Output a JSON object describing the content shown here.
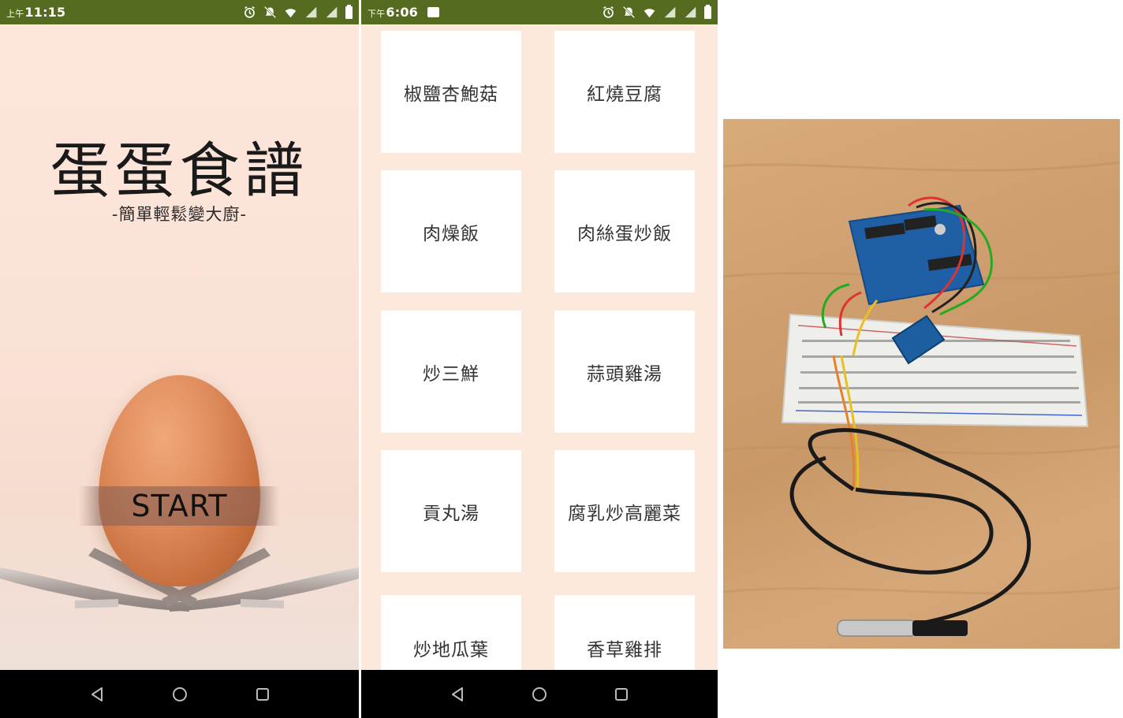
{
  "phone1": {
    "status": {
      "ampm": "上午",
      "time": "11:15"
    },
    "title": "蛋蛋食譜",
    "subtitle": "-簡單輕鬆變大廚-",
    "start_label": "START"
  },
  "phone2": {
    "status": {
      "ampm": "下午",
      "time": "6:06"
    },
    "recipes": [
      "椒鹽杏鮑菇",
      "紅燒豆腐",
      "肉燥飯",
      "肉絲蛋炒飯",
      "炒三鮮",
      "蒜頭雞湯",
      "貢丸湯",
      "腐乳炒高麗菜",
      "炒地瓜葉",
      "香草雞排"
    ]
  },
  "colors": {
    "statusbar": "#556b1f",
    "phone1_bg": "#fbe2d6",
    "phone2_bg": "#fde8dc",
    "card_bg": "#ffffff",
    "navbar": "#000000"
  },
  "icons": {
    "status": [
      "alarm-icon",
      "mute-icon",
      "wifi-icon",
      "signal-icon",
      "signal-icon",
      "battery-icon"
    ],
    "nav": [
      "back-icon",
      "home-icon",
      "recents-icon"
    ]
  }
}
